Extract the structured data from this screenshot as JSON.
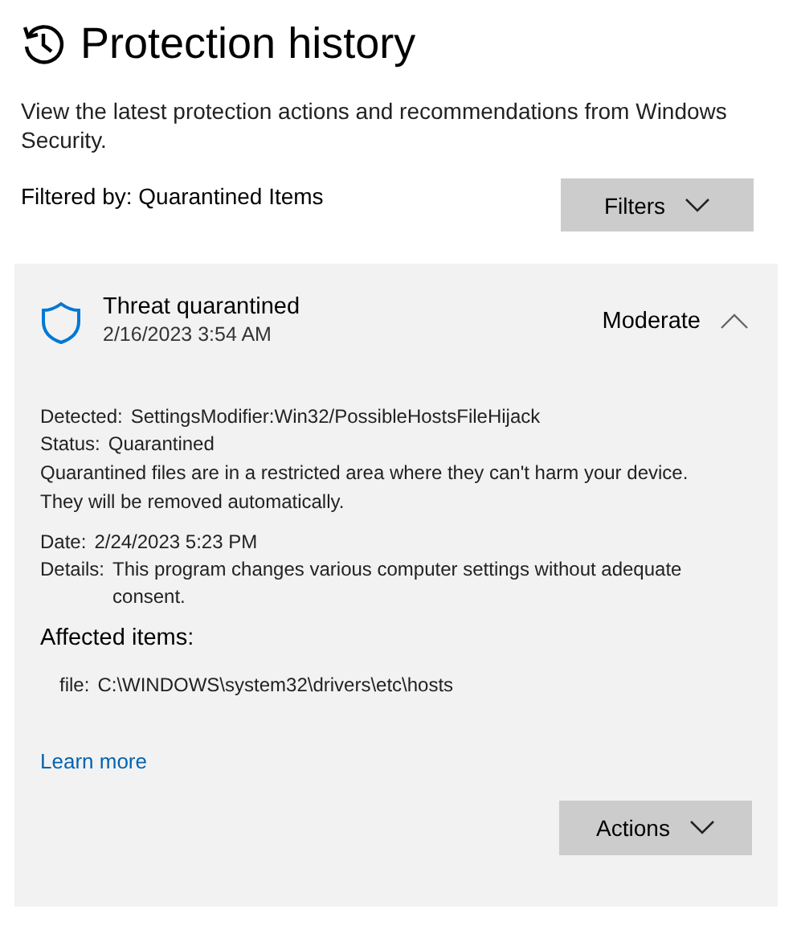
{
  "header": {
    "title": "Protection history"
  },
  "description": "View the latest protection actions and recommendations from Windows Security.",
  "filter": {
    "label": "Filtered by: Quarantined Items",
    "button": "Filters"
  },
  "threats": [
    {
      "title": "Threat quarantined",
      "date": "2/16/2023 3:54 AM",
      "severity": "Moderate",
      "expanded": true,
      "summary": [
        {
          "label": "Detected:",
          "value": "SettingsModifier:Win32/PossibleHostsFileHijack"
        },
        {
          "label": "Status:",
          "value": "Quarantined"
        }
      ],
      "note": "Quarantined files are in a restricted area where they can't harm your device. They will be removed automatically.",
      "info": [
        {
          "label": "Date:",
          "value": "2/24/2023 5:23 PM"
        },
        {
          "label": "Details:",
          "value": "This program changes various computer settings without adequate consent."
        }
      ],
      "affected_heading": "Affected items:",
      "affected_items": [
        {
          "label": "file:",
          "value": "C:\\WINDOWS\\system32\\drivers\\etc\\hosts"
        }
      ],
      "link": "Learn more",
      "actions_button": "Actions"
    }
  ]
}
